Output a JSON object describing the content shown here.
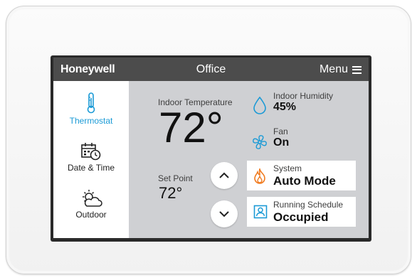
{
  "header": {
    "brand": "Honeywell",
    "zone": "Office",
    "menu_label": "Menu"
  },
  "sidebar": {
    "items": [
      {
        "label": "Thermostat",
        "icon": "thermometer-icon",
        "active": true
      },
      {
        "label": "Date & Time",
        "icon": "calendar-clock-icon",
        "active": false
      },
      {
        "label": "Outdoor",
        "icon": "sun-cloud-icon",
        "active": false
      }
    ]
  },
  "temperature": {
    "indoor_label": "Indoor Temperature",
    "indoor_value": "72°",
    "setpoint_label": "Set Point",
    "setpoint_value": "72°"
  },
  "humidity": {
    "label": "Indoor Humidity",
    "value": "45%"
  },
  "fan": {
    "label": "Fan",
    "value": "On"
  },
  "system": {
    "label": "System",
    "value": "Auto Mode"
  },
  "schedule": {
    "label": "Running Schedule",
    "value": "Occupied"
  },
  "colors": {
    "accent": "#1a9ad6",
    "header": "#4c4c4c",
    "flame": "#f07a1e",
    "panel": "#cfd0d3"
  }
}
